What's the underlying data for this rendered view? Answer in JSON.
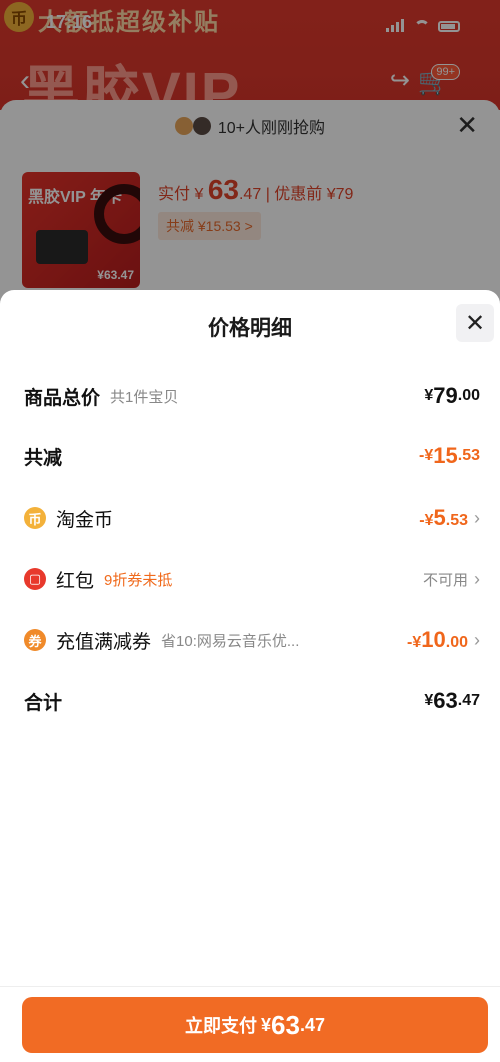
{
  "status_bar": {
    "time": "17:16"
  },
  "background": {
    "banner_text": "大额抵超级补贴",
    "hero_title": "黑胶VIP",
    "cart_badge": "99+",
    "grab_text": "10+人刚刚抢购",
    "product_title": "黑胶VIP 年卡",
    "product_price": "¥63.47",
    "pay_label": "实付",
    "pay_currency": "¥",
    "pay_int": "63",
    "pay_dec": ".47",
    "before_label": "优惠前 ¥79",
    "discount_label": "共减 ¥15.53 >"
  },
  "sheet": {
    "title": "价格明细",
    "rows": [
      {
        "label": "商品总价",
        "sub": "共1件宝贝",
        "cur": "¥",
        "int": "79",
        "dec": ".00"
      },
      {
        "label": "共减",
        "cur": "-¥",
        "int": "15",
        "dec": ".53"
      },
      {
        "label": "淘金币",
        "cur": "-¥",
        "int": "5",
        "dec": ".53"
      },
      {
        "label": "红包",
        "sub": "9折券未抵",
        "status": "不可用"
      },
      {
        "label": "充值满减券",
        "sub": "省10:网易云音乐优...",
        "cur": "-¥",
        "int": "10",
        "dec": ".00"
      },
      {
        "label": "合计",
        "cur": "¥",
        "int": "63",
        "dec": ".47"
      }
    ]
  },
  "footer": {
    "pay_label": "立即支付",
    "cur": "¥",
    "int": "63",
    "dec": ".47"
  },
  "colors": {
    "accent": "#f16b24",
    "red": "#e1442a"
  }
}
